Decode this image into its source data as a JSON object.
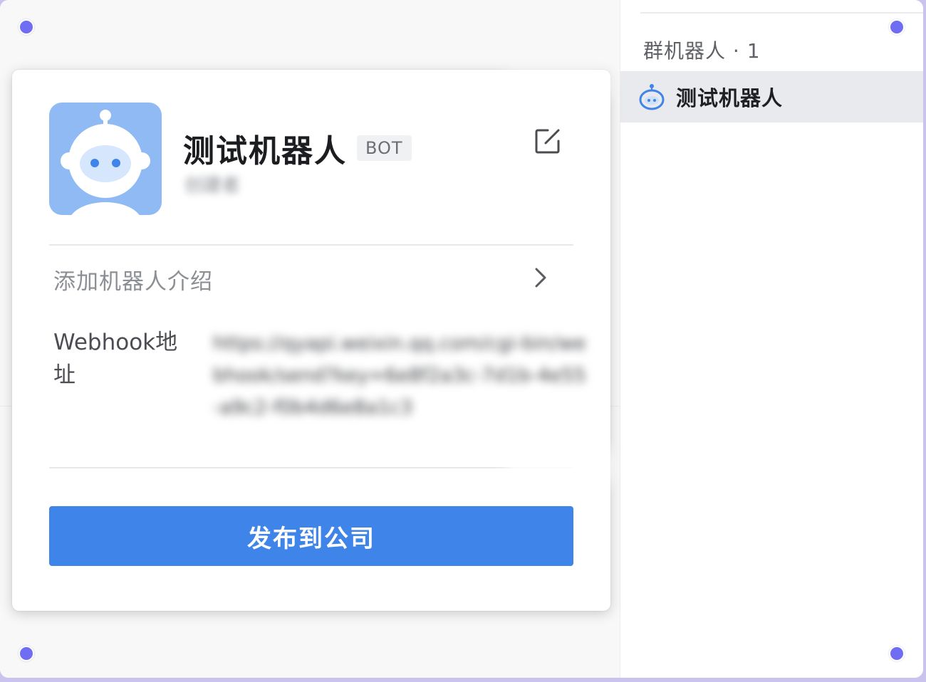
{
  "right_panel": {
    "group_header": "群机器人 · 1",
    "robots": [
      {
        "name": "测试机器人",
        "icon": "robot-icon"
      }
    ]
  },
  "card": {
    "bot_name": "测试机器人",
    "badge": "BOT",
    "creator": "创建者",
    "add_intro_label": "添加机器人介绍",
    "webhook_label": "Webhook地址",
    "webhook_value": "https://qyapi.weixin.qq.com/cgi-bin/webhook/send?key=6e8f2a3c-7d1b-4e55-a9c2-f0b4d6e8a1c3",
    "publish_button": "发布到公司"
  },
  "colors": {
    "accent": "#3f84e8",
    "avatar_bg": "#8fbaf4",
    "selected_row": "#e9eaee",
    "handle_dot": "#6f6ef3"
  }
}
